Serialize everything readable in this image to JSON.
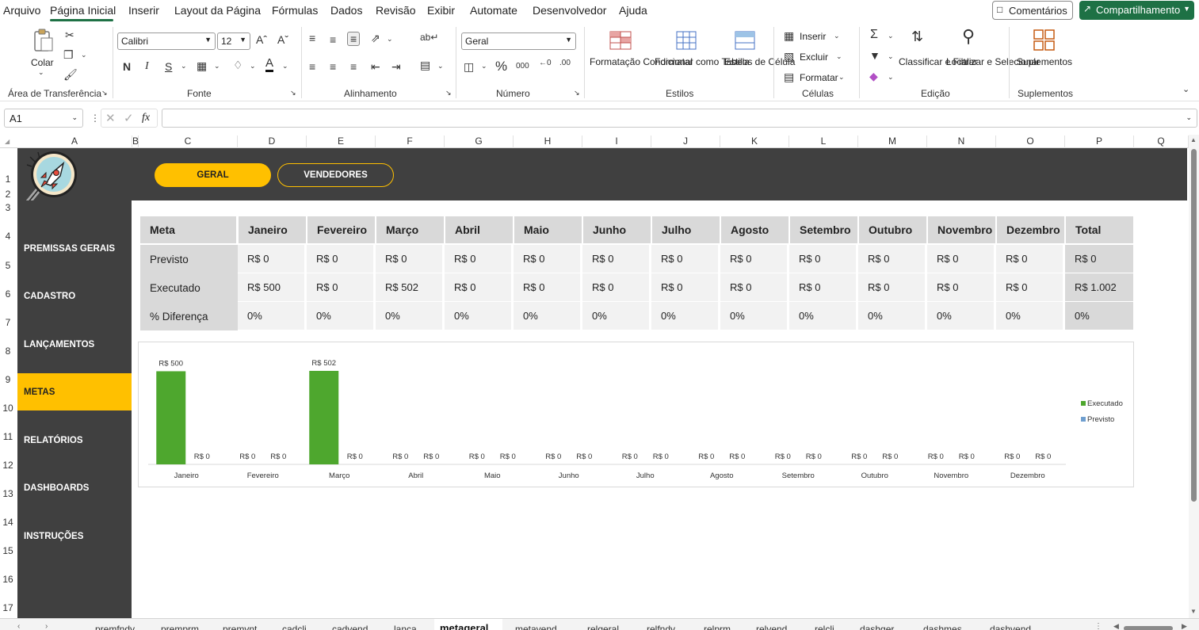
{
  "menu": {
    "items": [
      "Arquivo",
      "Página Inicial",
      "Inserir",
      "Layout da Página",
      "Fórmulas",
      "Dados",
      "Revisão",
      "Exibir",
      "Automate",
      "Desenvolvedor",
      "Ajuda"
    ],
    "comments_label": "Comentários",
    "share_label": "Compartilhamento"
  },
  "ribbon": {
    "clipboard": {
      "paste_label": "Colar",
      "group_label": "Área de Transferência"
    },
    "font": {
      "font_name": "Calibri",
      "font_size": "12",
      "bold": "N",
      "italic": "I",
      "underline": "S",
      "group_label": "Fonte"
    },
    "alignment": {
      "group_label": "Alinhamento"
    },
    "number": {
      "format": "Geral",
      "group_label": "Número"
    },
    "styles": {
      "cond_format": "Formatação Condicional",
      "format_table": "Formatar como Tabela",
      "cell_styles": "Estilos de Célula",
      "group_label": "Estilos"
    },
    "cells": {
      "insert": "Inserir",
      "delete": "Excluir",
      "format": "Formatar",
      "group_label": "Células"
    },
    "editing": {
      "sort_filter": "Classificar e Filtrar",
      "find_select": "Localizar e Selecionar",
      "group_label": "Edição"
    },
    "addins": {
      "label": "Suplementos",
      "group_label": "Suplementos"
    }
  },
  "formula_bar": {
    "name_box": "A1",
    "fx": "fx",
    "value": ""
  },
  "columns": [
    "A",
    "B",
    "C",
    "D",
    "E",
    "F",
    "G",
    "H",
    "I",
    "J",
    "K",
    "L",
    "M",
    "N",
    "O",
    "P",
    "Q"
  ],
  "rows": [
    "1",
    "2",
    "3",
    "4",
    "5",
    "6",
    "7",
    "8",
    "9",
    "10",
    "11",
    "12",
    "13",
    "14",
    "15",
    "16",
    "17"
  ],
  "top_buttons": {
    "geral": "GERAL",
    "vendedores": "VENDEDORES"
  },
  "sidebar": {
    "items": [
      "PREMISSAS GERAIS",
      "CADASTRO",
      "LANÇAMENTOS",
      "METAS",
      "RELATÓRIOS",
      "DASHBOARDS",
      "INSTRUÇÕES"
    ],
    "active": "METAS"
  },
  "table": {
    "headers": [
      "Meta",
      "Janeiro",
      "Fevereiro",
      "Março",
      "Abril",
      "Maio",
      "Junho",
      "Julho",
      "Agosto",
      "Setembro",
      "Outubro",
      "Novembro",
      "Dezembro",
      "Total"
    ],
    "rows": [
      {
        "label": "Previsto",
        "values": [
          "R$ 0",
          "R$ 0",
          "R$ 0",
          "R$ 0",
          "R$ 0",
          "R$ 0",
          "R$ 0",
          "R$ 0",
          "R$ 0",
          "R$ 0",
          "R$ 0",
          "R$ 0",
          "R$ 0"
        ]
      },
      {
        "label": "Executado",
        "values": [
          "R$ 500",
          "R$ 0",
          "R$ 502",
          "R$ 0",
          "R$ 0",
          "R$ 0",
          "R$ 0",
          "R$ 0",
          "R$ 0",
          "R$ 0",
          "R$ 0",
          "R$ 0",
          "R$ 1.002"
        ]
      },
      {
        "label": "% Diferença",
        "values": [
          "0%",
          "0%",
          "0%",
          "0%",
          "0%",
          "0%",
          "0%",
          "0%",
          "0%",
          "0%",
          "0%",
          "0%",
          "0%"
        ]
      }
    ]
  },
  "chart_data": {
    "type": "bar",
    "categories": [
      "Janeiro",
      "Fevereiro",
      "Março",
      "Abril",
      "Maio",
      "Junho",
      "Julho",
      "Agosto",
      "Setembro",
      "Outubro",
      "Novembro",
      "Dezembro"
    ],
    "series": [
      {
        "name": "Executado",
        "color": "#4ea72e",
        "values": [
          500,
          0,
          502,
          0,
          0,
          0,
          0,
          0,
          0,
          0,
          0,
          0
        ],
        "labels": [
          "R$ 500",
          "R$ 0",
          "R$ 502",
          "R$ 0",
          "R$ 0",
          "R$ 0",
          "R$ 0",
          "R$ 0",
          "R$ 0",
          "R$ 0",
          "R$ 0",
          "R$ 0"
        ]
      },
      {
        "name": "Previsto",
        "color": "#6f9fcf",
        "values": [
          0,
          0,
          0,
          0,
          0,
          0,
          0,
          0,
          0,
          0,
          0,
          0
        ],
        "labels": [
          "R$ 0",
          "R$ 0",
          "R$ 0",
          "R$ 0",
          "R$ 0",
          "R$ 0",
          "R$ 0",
          "R$ 0",
          "R$ 0",
          "R$ 0",
          "R$ 0",
          "R$ 0"
        ]
      }
    ],
    "ylim": [
      0,
      502
    ],
    "legend": "right"
  },
  "sheet_tabs": [
    "premfndy",
    "premprm",
    "premvnt",
    "cadcli",
    "cadvend",
    "lanca",
    "metageral",
    "metavend",
    "relgeral",
    "relfndy",
    "relprm",
    "relvend",
    "relcli",
    "dashger",
    "dashmes",
    "dashvend"
  ],
  "active_tab": "metageral",
  "colors": {
    "dark": "#404040",
    "accent": "#ffc000",
    "excel_green": "#1e7145"
  }
}
